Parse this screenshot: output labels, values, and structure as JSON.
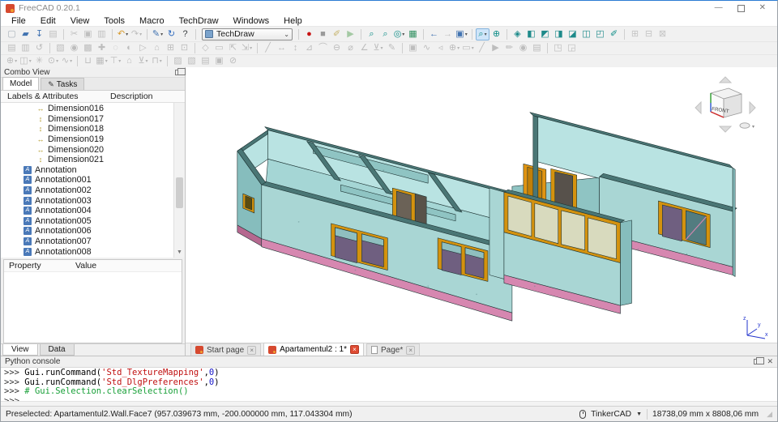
{
  "window": {
    "title": "FreeCAD 0.20.1"
  },
  "menu": [
    "File",
    "Edit",
    "View",
    "Tools",
    "Macro",
    "TechDraw",
    "Windows",
    "Help"
  ],
  "workbench": {
    "value": "TechDraw"
  },
  "toolbars": {
    "row1": [
      {
        "n": "new-file",
        "g": "▢",
        "c": "#a9b2ba"
      },
      {
        "n": "open-file",
        "g": "▰",
        "c": "#4173b1"
      },
      {
        "n": "save-file",
        "g": "↧",
        "c": "#4173b1"
      },
      {
        "n": "print",
        "g": "▤",
        "c": "#bfbfbf",
        "d": 1
      },
      {
        "sep": 1
      },
      {
        "n": "cut",
        "g": "✂",
        "c": "#bfbfbf",
        "d": 1
      },
      {
        "n": "copy",
        "g": "▣",
        "c": "#bfbfbf",
        "d": 1
      },
      {
        "n": "paste",
        "g": "▥",
        "c": "#bfbfbf",
        "d": 1
      },
      {
        "sep": 1
      },
      {
        "n": "undo",
        "g": "↶",
        "c": "#d79a2c",
        "v": 1
      },
      {
        "n": "redo",
        "g": "↷",
        "c": "#bfbfbf",
        "d": 1,
        "v": 1
      },
      {
        "sep": 1
      },
      {
        "n": "edit-mode",
        "g": "✎",
        "c": "#4173b1",
        "v": 1
      },
      {
        "n": "refresh",
        "g": "↻",
        "c": "#2f6bbf"
      },
      {
        "n": "whats-this",
        "g": "?",
        "c": "#3c4043"
      },
      {
        "sep": 1
      },
      {
        "wb": 1
      },
      {
        "sep": 1
      },
      {
        "n": "macro-record",
        "g": "●",
        "c": "#c81414"
      },
      {
        "n": "macro-stop",
        "g": "■",
        "c": "#9a9a9a"
      },
      {
        "n": "macro-edit",
        "g": "✐",
        "c": "#c6b36a",
        "d": 1
      },
      {
        "n": "macro-play",
        "g": "▶",
        "c": "#a4c9a4",
        "d": 1
      },
      {
        "sep": 1
      },
      {
        "n": "box-element-selection",
        "g": "⌕",
        "c": "#0e8d87"
      },
      {
        "n": "box-zoom",
        "g": "⌕",
        "c": "#0e8d87"
      },
      {
        "n": "draw-style",
        "g": "◎",
        "c": "#0e8d87",
        "v": 1
      },
      {
        "n": "texture-view",
        "g": "▦",
        "c": "#2f8f5f"
      },
      {
        "sep": 1
      },
      {
        "n": "nav-back",
        "g": "←",
        "c": "#4173b1"
      },
      {
        "n": "nav-forward",
        "g": "→",
        "c": "#bfbfbf",
        "d": 1
      },
      {
        "n": "linked-view",
        "g": "▣",
        "c": "#4173b1",
        "v": 1
      },
      {
        "sep": 1
      },
      {
        "n": "zoom-tool",
        "g": "⌕",
        "c": "#0e8d87",
        "v": 1,
        "hl": 1
      },
      {
        "n": "fit-all",
        "g": "⊕",
        "c": "#0e8d87"
      },
      {
        "sep": 1
      },
      {
        "n": "view-axonometric",
        "g": "◈",
        "c": "#1d8a8a"
      },
      {
        "n": "view-front",
        "g": "◧",
        "c": "#1d8a8a"
      },
      {
        "n": "view-top",
        "g": "◩",
        "c": "#1d8a8a"
      },
      {
        "n": "view-right",
        "g": "◨",
        "c": "#1d8a8a"
      },
      {
        "n": "view-rear",
        "g": "◪",
        "c": "#1d8a8a"
      },
      {
        "n": "view-bottom",
        "g": "◫",
        "c": "#1d8a8a"
      },
      {
        "n": "view-left",
        "g": "◰",
        "c": "#1d8a8a"
      },
      {
        "n": "measure-distance",
        "g": "✐",
        "c": "#0e8d87"
      },
      {
        "sep": 1
      },
      {
        "n": "clip-plane",
        "g": "⊞",
        "c": "#c4c4c4",
        "d": 1
      },
      {
        "n": "persistent-section",
        "g": "⊟",
        "c": "#c4c4c4",
        "d": 1
      },
      {
        "n": "section-cut",
        "g": "⊠",
        "c": "#c4c4c4",
        "d": 1
      }
    ],
    "row2": [
      {
        "n": "td-insert-page",
        "g": "▤",
        "c": "#bdbdbd",
        "d": 1
      },
      {
        "n": "td-page-template",
        "g": "▥",
        "c": "#bdbdbd",
        "d": 1
      },
      {
        "n": "td-redraw-page",
        "g": "↺",
        "c": "#bdbdbd",
        "d": 1
      },
      {
        "sep": 1
      },
      {
        "n": "td-insert-view",
        "g": "▧",
        "c": "#bdbdbd",
        "d": 1
      },
      {
        "n": "td-active-view",
        "g": "◉",
        "c": "#bdbdbd",
        "d": 1
      },
      {
        "n": "td-projection-group",
        "g": "▩",
        "c": "#bdbdbd",
        "d": 1
      },
      {
        "n": "td-section-view",
        "g": "✚",
        "c": "#bdbdbd",
        "d": 1
      },
      {
        "n": "td-complex-section",
        "g": "◌",
        "c": "#bdbdbd",
        "d": 1
      },
      {
        "n": "td-detail-view",
        "g": "◐",
        "c": "#bdbdbd",
        "d": 1
      },
      {
        "n": "td-draft-view",
        "g": "▷",
        "c": "#bdbdbd",
        "d": 1
      },
      {
        "n": "td-arch-view",
        "g": "⌂",
        "c": "#bdbdbd",
        "d": 1
      },
      {
        "n": "td-spreadsheet-view",
        "g": "⊞",
        "c": "#bdbdbd",
        "d": 1
      },
      {
        "n": "td-clip-group",
        "g": "⊡",
        "c": "#bdbdbd",
        "d": 1
      },
      {
        "sep": 1
      },
      {
        "n": "td-clip-new",
        "g": "◇",
        "c": "#bdbdbd",
        "d": 1
      },
      {
        "n": "td-clip-add",
        "g": "▭",
        "c": "#bdbdbd",
        "d": 1
      },
      {
        "n": "td-export-svg",
        "g": "⇱",
        "c": "#bdbdbd",
        "d": 1
      },
      {
        "n": "td-export-dxf",
        "g": "⇲",
        "c": "#bdbdbd",
        "d": 1,
        "v": 1
      },
      {
        "sep": 1
      },
      {
        "n": "td-dim-length",
        "g": "╱",
        "c": "#bdbdbd",
        "d": 1
      },
      {
        "n": "td-dim-horizontal",
        "g": "↔",
        "c": "#bdbdbd",
        "d": 1
      },
      {
        "n": "td-dim-vertical",
        "g": "↕",
        "c": "#bdbdbd",
        "d": 1
      },
      {
        "n": "td-dim-angle",
        "g": "⊿",
        "c": "#bdbdbd",
        "d": 1
      },
      {
        "n": "td-dim-arc",
        "g": "⌒",
        "c": "#bdbdbd",
        "d": 1
      },
      {
        "n": "td-dim-radius",
        "g": "⊖",
        "c": "#bdbdbd",
        "d": 1
      },
      {
        "n": "td-dim-diameter",
        "g": "⌀",
        "c": "#bdbdbd",
        "d": 1
      },
      {
        "n": "td-dim-angle3pt",
        "g": "∠",
        "c": "#bdbdbd",
        "d": 1
      },
      {
        "n": "td-dim-extent",
        "g": "⊻",
        "c": "#bdbdbd",
        "d": 1,
        "v": 1
      },
      {
        "n": "td-dim-repair",
        "g": "✎",
        "c": "#bdbdbd",
        "d": 1
      },
      {
        "sep": 1
      },
      {
        "n": "td-annot-text",
        "g": "▣",
        "c": "#bdbdbd",
        "d": 1
      },
      {
        "n": "td-annot-leader",
        "g": "∿",
        "c": "#bdbdbd",
        "d": 1
      },
      {
        "n": "td-annot-rich",
        "g": "◃",
        "c": "#bdbdbd",
        "d": 1
      },
      {
        "n": "td-annot-balloon",
        "g": "⊕",
        "c": "#bdbdbd",
        "d": 1,
        "v": 1
      },
      {
        "n": "td-annot-cosmetic",
        "g": "▭",
        "c": "#bdbdbd",
        "d": 1,
        "v": 1
      },
      {
        "n": "td-annot-centerline",
        "g": "╱",
        "c": "#bdbdbd",
        "d": 1
      },
      {
        "n": "td-annot-welding",
        "g": "▶",
        "c": "#bdbdbd",
        "d": 1
      },
      {
        "n": "td-annot-surface",
        "g": "✏",
        "c": "#bdbdbd",
        "d": 1
      },
      {
        "n": "td-annot-hole-axis",
        "g": "◉",
        "c": "#bdbdbd",
        "d": 1
      },
      {
        "n": "td-annot-image",
        "g": "▤",
        "c": "#bdbdbd",
        "d": 1
      },
      {
        "sep": 1
      },
      {
        "n": "td-ext-select-line",
        "g": "◳",
        "c": "#bdbdbd",
        "d": 1
      },
      {
        "n": "td-ext-change-line",
        "g": "◲",
        "c": "#bdbdbd",
        "d": 1
      }
    ],
    "row3": [
      {
        "n": "td-ext-circle-center",
        "g": "⊕",
        "c": "#bdbdbd",
        "d": 1,
        "v": 1
      },
      {
        "n": "td-ext-vertex-chain",
        "g": "◫",
        "c": "#bdbdbd",
        "d": 1,
        "v": 1
      },
      {
        "n": "td-ext-thread",
        "g": "✳",
        "c": "#bdbdbd",
        "d": 1
      },
      {
        "n": "td-ext-hole-circle",
        "g": "⊙",
        "c": "#bdbdbd",
        "d": 1,
        "v": 1
      },
      {
        "n": "td-ext-parallel",
        "g": "∿",
        "c": "#bdbdbd",
        "d": 1,
        "v": 1
      },
      {
        "sep": 1
      },
      {
        "n": "td-ext-ppgroup",
        "g": "⊔",
        "c": "#bdbdbd",
        "d": 1
      },
      {
        "n": "td-ext-dim-grid",
        "g": "▦",
        "c": "#bdbdbd",
        "d": 1,
        "v": 1
      },
      {
        "n": "td-ext-chamfer",
        "g": "⊤",
        "c": "#bdbdbd",
        "d": 1,
        "v": 1
      },
      {
        "n": "td-ext-arch",
        "g": "⌂",
        "c": "#bdbdbd",
        "d": 1
      },
      {
        "n": "td-ext-anchor",
        "g": "⊻",
        "c": "#bdbdbd",
        "d": 1,
        "v": 1
      },
      {
        "n": "td-ext-cascade",
        "g": "⊓",
        "c": "#bdbdbd",
        "d": 1,
        "v": 1
      },
      {
        "sep": 1
      },
      {
        "n": "td-stack-top",
        "g": "▨",
        "c": "#bdbdbd",
        "d": 1
      },
      {
        "n": "td-stack-up",
        "g": "▧",
        "c": "#bdbdbd",
        "d": 1
      },
      {
        "n": "td-stack-down",
        "g": "▤",
        "c": "#bdbdbd",
        "d": 1
      },
      {
        "n": "td-stack-bottom",
        "g": "▣",
        "c": "#bdbdbd",
        "d": 1
      },
      {
        "n": "td-hide-frames",
        "g": "⊘",
        "c": "#bdbdbd",
        "d": 1
      }
    ]
  },
  "combo_view": {
    "title": "Combo View",
    "tabs": [
      {
        "label": "Model",
        "active": true
      },
      {
        "label": "Tasks",
        "icon": "pencil"
      }
    ],
    "tree": {
      "columns": [
        "Labels & Attributes",
        "Description"
      ],
      "items": [
        {
          "icon": "dim-h",
          "label": "Dimension016",
          "lvl": 2
        },
        {
          "icon": "dim-v",
          "label": "Dimension017",
          "lvl": 2
        },
        {
          "icon": "dim-v",
          "label": "Dimension018",
          "lvl": 2
        },
        {
          "icon": "dim-h",
          "label": "Dimension019",
          "lvl": 2
        },
        {
          "icon": "dim-h",
          "label": "Dimension020",
          "lvl": 2
        },
        {
          "icon": "dim-v",
          "label": "Dimension021",
          "lvl": 2
        },
        {
          "icon": "annotation",
          "label": "Annotation",
          "lvl": 1
        },
        {
          "icon": "annotation",
          "label": "Annotation001",
          "lvl": 1
        },
        {
          "icon": "annotation",
          "label": "Annotation002",
          "lvl": 1
        },
        {
          "icon": "annotation",
          "label": "Annotation003",
          "lvl": 1
        },
        {
          "icon": "annotation",
          "label": "Annotation004",
          "lvl": 1
        },
        {
          "icon": "annotation",
          "label": "Annotation005",
          "lvl": 1
        },
        {
          "icon": "annotation",
          "label": "Annotation006",
          "lvl": 1
        },
        {
          "icon": "annotation",
          "label": "Annotation007",
          "lvl": 1
        },
        {
          "icon": "annotation",
          "label": "Annotation008",
          "lvl": 1
        }
      ]
    },
    "property_panel": {
      "columns": [
        "Property",
        "Value"
      ]
    },
    "bottom_tabs": [
      {
        "label": "View",
        "active": true
      },
      {
        "label": "Data"
      }
    ]
  },
  "icons": {
    "dim-h": {
      "g": "↔",
      "c": "#b29a28"
    },
    "dim-v": {
      "g": "↕",
      "c": "#b29a28"
    },
    "annotation": {
      "g": "A",
      "c": "#ffffff",
      "bg": "#4a79b8"
    },
    "pencil": {
      "g": "✎",
      "c": "#333333"
    }
  },
  "viewport": {
    "mdi_tabs": [
      {
        "label": "Start page",
        "icon": "freecad",
        "close": "gray"
      },
      {
        "label": "Apartamentul2 : 1*",
        "icon": "freecad",
        "close": "red",
        "active": true
      },
      {
        "label": "Page*",
        "icon": "page",
        "close": "gray"
      }
    ],
    "nav_cube": {
      "front_label": "FRONT"
    },
    "axis_labels": {
      "x": "x",
      "y": "y",
      "z": "z"
    },
    "model_colors": {
      "wall_light": "#b9e3e2",
      "room_floor": "#a5d6d5",
      "wall_mid": "#a9d6d4",
      "wall_inner": "#8fc4c3",
      "wall_shade": "#86bdbd",
      "wall_top": "#4a7675",
      "frame_orange": "#d4920e",
      "door_bright": "#e09412",
      "door_mid": "#c07f08",
      "glass_purple": "#6f5f80",
      "glass_sliver": "#8fbfbf",
      "glass_pale": "#d8dabe",
      "glass_teal": "#527c80",
      "plinth_pink": "#d687b0",
      "plinth_shade": "#b5688f"
    }
  },
  "python_console": {
    "title": "Python console",
    "lines": [
      [
        [
          "p",
          ">>> "
        ],
        [
          "c",
          "Gui.runCommand("
        ],
        [
          "s",
          "'Std_TextureMapping'"
        ],
        [
          "c",
          ","
        ],
        [
          "n",
          "0"
        ],
        [
          "c",
          ")"
        ]
      ],
      [
        [
          "p",
          ">>> "
        ],
        [
          "c",
          "Gui.runCommand("
        ],
        [
          "s",
          "'Std_DlgPreferences'"
        ],
        [
          "c",
          ","
        ],
        [
          "n",
          "0"
        ],
        [
          "c",
          ")"
        ]
      ],
      [
        [
          "p",
          ">>> "
        ],
        [
          "m",
          "# Gui.Selection.clearSelection()"
        ]
      ],
      [
        [
          "p",
          ">>>"
        ]
      ]
    ]
  },
  "status_bar": {
    "left": "Preselected: Apartamentul2.Wall.Face7 (957.039673 mm, -200.000000 mm, 117.043304 mm)",
    "nav_style": "TinkerCAD",
    "dimensions": "18738,09 mm x 8808,06 mm"
  }
}
